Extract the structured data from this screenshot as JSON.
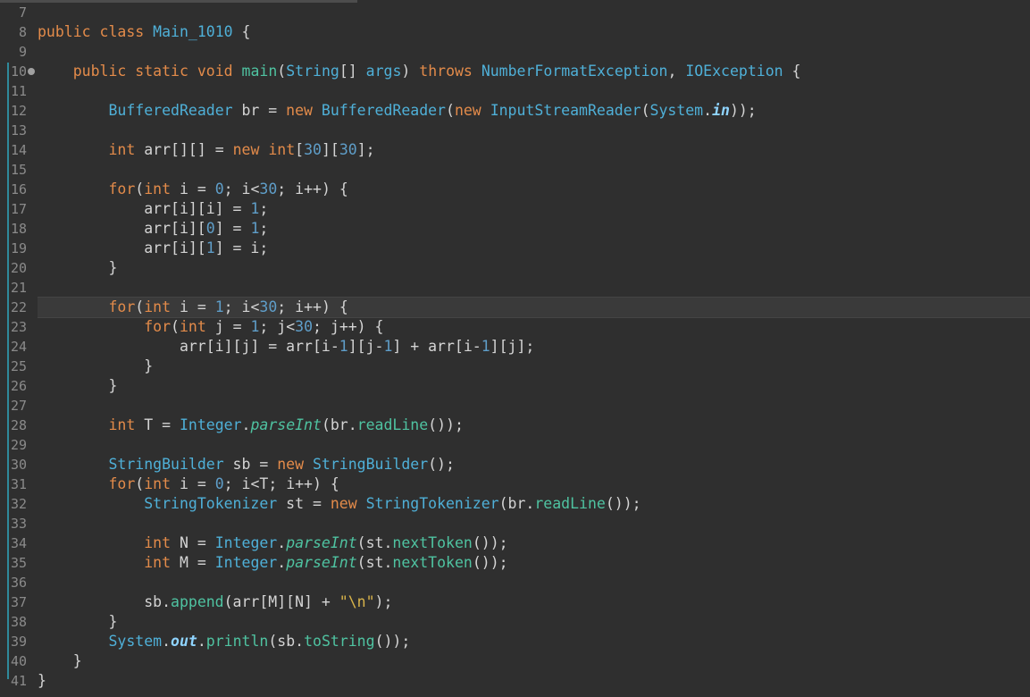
{
  "editor": {
    "lines": [
      {
        "num": "7",
        "code": ""
      },
      {
        "num": "8",
        "code": "public class Main_1010 {"
      },
      {
        "num": "9",
        "code": ""
      },
      {
        "num": "10",
        "code": "    public static void main(String[] args) throws NumberFormatException, IOException {"
      },
      {
        "num": "11",
        "code": ""
      },
      {
        "num": "12",
        "code": "        BufferedReader br = new BufferedReader(new InputStreamReader(System.in));"
      },
      {
        "num": "13",
        "code": ""
      },
      {
        "num": "14",
        "code": "        int arr[][] = new int[30][30];"
      },
      {
        "num": "15",
        "code": ""
      },
      {
        "num": "16",
        "code": "        for(int i = 0; i<30; i++) {"
      },
      {
        "num": "17",
        "code": "            arr[i][i] = 1;"
      },
      {
        "num": "18",
        "code": "            arr[i][0] = 1;"
      },
      {
        "num": "19",
        "code": "            arr[i][1] = i;"
      },
      {
        "num": "20",
        "code": "        }"
      },
      {
        "num": "21",
        "code": ""
      },
      {
        "num": "22",
        "code": "        for(int i = 1; i<30; i++) {"
      },
      {
        "num": "23",
        "code": "            for(int j = 1; j<30; j++) {"
      },
      {
        "num": "24",
        "code": "                arr[i][j] = arr[i-1][j-1] + arr[i-1][j];"
      },
      {
        "num": "25",
        "code": "            }"
      },
      {
        "num": "26",
        "code": "        }"
      },
      {
        "num": "27",
        "code": ""
      },
      {
        "num": "28",
        "code": "        int T = Integer.parseInt(br.readLine());"
      },
      {
        "num": "29",
        "code": ""
      },
      {
        "num": "30",
        "code": "        StringBuilder sb = new StringBuilder();"
      },
      {
        "num": "31",
        "code": "        for(int i = 0; i<T; i++) {"
      },
      {
        "num": "32",
        "code": "            StringTokenizer st = new StringTokenizer(br.readLine());"
      },
      {
        "num": "33",
        "code": ""
      },
      {
        "num": "34",
        "code": "            int N = Integer.parseInt(st.nextToken());"
      },
      {
        "num": "35",
        "code": "            int M = Integer.parseInt(st.nextToken());"
      },
      {
        "num": "36",
        "code": ""
      },
      {
        "num": "37",
        "code": "            sb.append(arr[M][N] + \"\\n\");"
      },
      {
        "num": "38",
        "code": "        }"
      },
      {
        "num": "39",
        "code": "        System.out.println(sb.toString());"
      },
      {
        "num": "40",
        "code": "    }"
      },
      {
        "num": "41",
        "code": "}"
      }
    ],
    "colors": {
      "background": "#2f2f2f",
      "keyword": "#e38b4a",
      "type": "#4fb0d8",
      "method": "#4fc3a1",
      "number": "#5f9ec9",
      "string": "#d9b44a",
      "gutter_marker": "#2f8a9b"
    },
    "icons": [
      "fold-collapse-icon"
    ]
  }
}
